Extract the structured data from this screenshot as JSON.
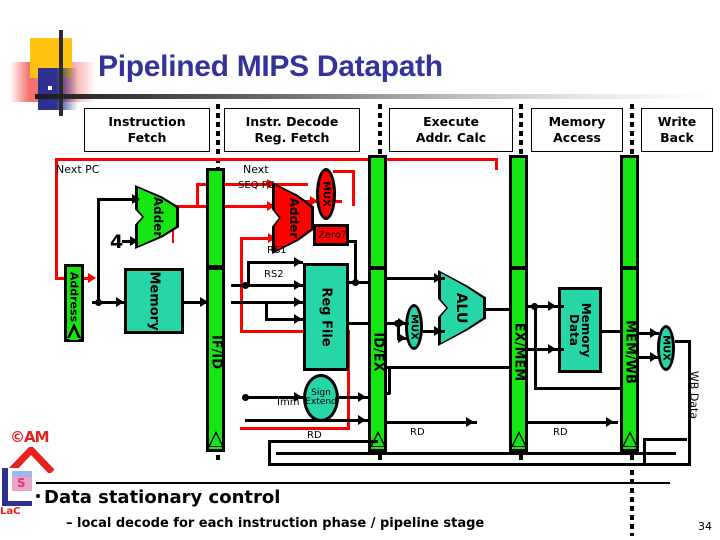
{
  "slide": {
    "title": "Pipelined MIPS Datapath",
    "page_number": "34",
    "title_color": "#333399"
  },
  "stages": [
    {
      "name": "instruction-fetch",
      "line1": "Instruction",
      "line2": "Fetch"
    },
    {
      "name": "instr-decode",
      "line1": "Instr. Decode",
      "line2": "Reg. Fetch"
    },
    {
      "name": "execute",
      "line1": "Execute",
      "line2": "Addr. Calc"
    },
    {
      "name": "memory-access",
      "line1": "Memory",
      "line2": "Access"
    },
    {
      "name": "write-back",
      "line1": "Write",
      "line2": "Back"
    }
  ],
  "datapath": {
    "next_pc": "Next PC",
    "next": "Next",
    "seq_pc": "SEQ PC",
    "four": "4",
    "adder_if": "Adder",
    "adder_id": "Adder",
    "mux_branch": "MUX",
    "zero": "Zero?",
    "address_reg": "Address",
    "instr_memory": "Memory",
    "reg_file": "Reg File",
    "sign_extend_l1": "Sign",
    "sign_extend_l2": "Extend",
    "rs1": "RS1",
    "rs2": "RS2",
    "imm": "Imm",
    "rd_id": "RD",
    "rd_ex": "RD",
    "rd_mem": "RD",
    "alu": "ALU",
    "mux_alu": "MUX",
    "mux_wb": "MUX",
    "data_memory_l1": "Data",
    "data_memory_l2": "Memory",
    "wb_data": "WB Data",
    "pipe_if_id": "IF/ID",
    "pipe_id_ex": "ID/EX",
    "pipe_ex_mem": "EX/MEM",
    "pipe_mem_wb": "MEM/WB",
    "colors": {
      "green": "#15E612",
      "teal": "#26D6A8",
      "red": "#FF0000",
      "black": "#000000"
    }
  },
  "body": {
    "bullet": "Data stationary control",
    "subbullet": "– local decode for each instruction phase / pipeline stage"
  },
  "logo": {
    "mark": "©AM",
    "book_letter": "S",
    "caption": "LaC"
  }
}
